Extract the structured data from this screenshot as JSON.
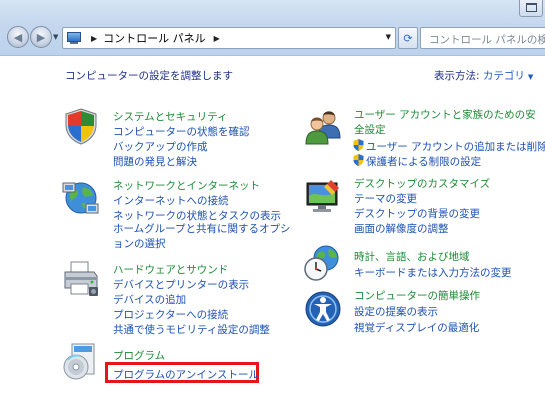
{
  "address_bar": {
    "path": "コントロール パネル",
    "search_placeholder": "コントロール パネルの検索"
  },
  "content": {
    "heading": "コンピューターの設定を調整します",
    "view_by_label": "表示方法:",
    "view_by_value": "カテゴリ"
  },
  "categories": {
    "system": {
      "title": "システムとセキュリティ",
      "links": [
        "コンピューターの状態を確認",
        "バックアップの作成",
        "問題の発見と解決"
      ]
    },
    "network": {
      "title": "ネットワークとインターネット",
      "links": [
        "インターネットへの接続",
        "ネットワークの状態とタスクの表示",
        "ホームグループと共有に関するオプションの選択"
      ]
    },
    "hardware": {
      "title": "ハードウェアとサウンド",
      "links": [
        "デバイスとプリンターの表示",
        "デバイスの追加",
        "プロジェクターへの接続",
        "共通で使うモビリティ設定の調整"
      ]
    },
    "programs": {
      "title": "プログラム",
      "links": [
        "プログラムのアンインストール"
      ]
    },
    "user_accounts": {
      "title": "ユーザー アカウントと家族のための安全設定",
      "links": [
        "ユーザー アカウントの追加または削除",
        "保護者による制限の設定"
      ]
    },
    "appearance": {
      "title": "デスクトップのカスタマイズ",
      "links": [
        "テーマの変更",
        "デスクトップの背景の変更",
        "画面の解像度の調整"
      ]
    },
    "clock": {
      "title": "時計、言語、および地域",
      "links": [
        "キーボードまたは入力方法の変更"
      ]
    },
    "ease": {
      "title": "コンピューターの簡単操作",
      "links": [
        "設定の提案の表示",
        "視覚ディスプレイの最適化"
      ]
    }
  },
  "colors": {
    "category_title": "#1d8a35",
    "link": "#1c51b5",
    "highlight_box": "#e8141b"
  },
  "icons": {
    "system": "shield-icon",
    "network": "globe-network-icon",
    "hardware": "printer-icon",
    "programs": "programs-disc-icon",
    "user_accounts": "users-icon",
    "appearance": "monitor-paint-icon",
    "clock": "clock-globe-icon",
    "ease": "ease-of-access-icon",
    "uac_shield": "uac-shield-icon"
  }
}
